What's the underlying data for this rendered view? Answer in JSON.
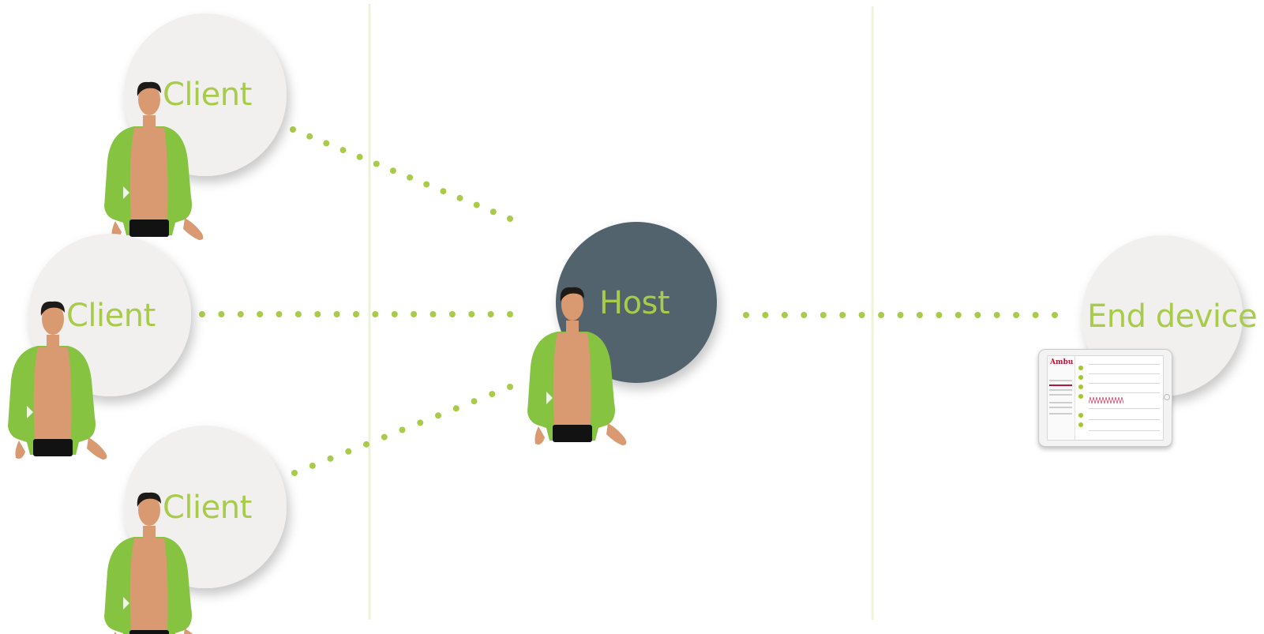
{
  "nodes": {
    "client_top": {
      "label": "Client"
    },
    "client_middle": {
      "label": "Client"
    },
    "client_bottom": {
      "label": "Client"
    },
    "host": {
      "label": "Host"
    },
    "end_device": {
      "label": "End device"
    }
  },
  "tablet": {
    "logo": "Ambu"
  },
  "colors": {
    "accent": "#a8cc4a",
    "circle_light": "#f1f0ef",
    "circle_dark": "#53646d",
    "divider": "#eef3d8",
    "jacket": "#86c340",
    "skin": "#d99a72",
    "hair": "#1e1a18",
    "pants": "#121212"
  },
  "icons": {
    "manikin": "cpr-manikin-icon",
    "tablet": "tablet-icon"
  }
}
